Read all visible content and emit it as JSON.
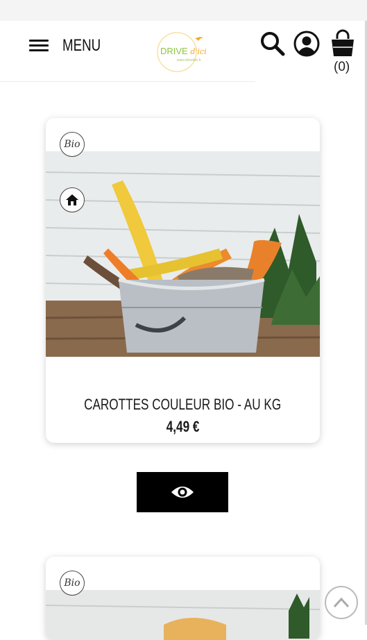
{
  "header": {
    "menu_label": "MENU",
    "logo": {
      "name": "DRIVE",
      "accent": "d'ici",
      "tagline": "www.drivedici.fr"
    },
    "cart_count": "(0)",
    "icons": [
      "search-icon",
      "account-icon",
      "cart-icon",
      "hamburger-icon"
    ]
  },
  "products": [
    {
      "name": "CAROTTES COULEUR BIO - AU KG",
      "price": "4,49 €",
      "badges": [
        "Bio",
        "Local"
      ]
    },
    {
      "badges": [
        "Bio"
      ]
    }
  ],
  "actions": {
    "view_icon": "eye-icon",
    "scroll_top_icon": "chevron-up-icon"
  },
  "colors": {
    "brand_green": "#8cc63f",
    "brand_orange": "#f4a623",
    "button_black": "#000000"
  }
}
